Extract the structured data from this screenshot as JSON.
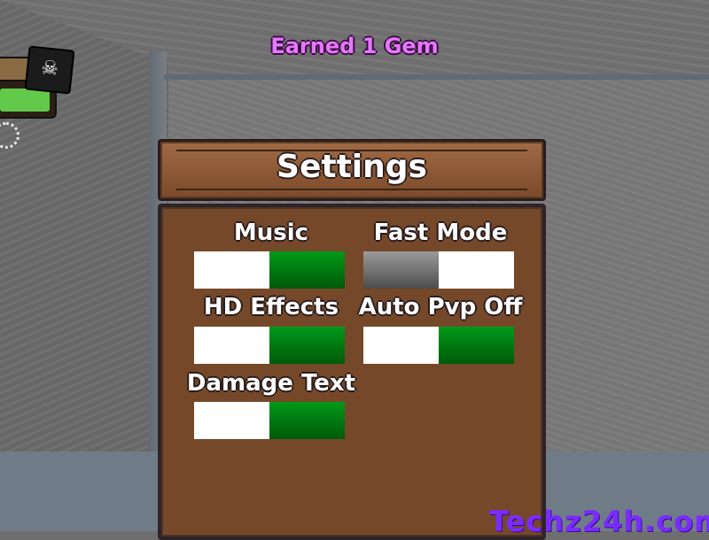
{
  "notification": "Earned 1 Gem",
  "settings": {
    "title": "Settings",
    "options": [
      {
        "label": "Music",
        "enabled": true
      },
      {
        "label": "Fast Mode",
        "enabled": false
      },
      {
        "label": "HD Effects",
        "enabled": true
      },
      {
        "label": "Auto Pvp Off",
        "enabled": true
      },
      {
        "label": "Damage Text",
        "enabled": true
      }
    ]
  },
  "hud": {
    "chest_icon": "treasure-chest-icon",
    "flag_icon": "pirate-flag-icon",
    "settings_icon": "gear-icon"
  },
  "watermark": "Techz24h.com",
  "colors": {
    "panel": "#75482a",
    "toggle_on": "#00760f",
    "toggle_off": "#6c6c6c",
    "notification": "#e678ff"
  }
}
